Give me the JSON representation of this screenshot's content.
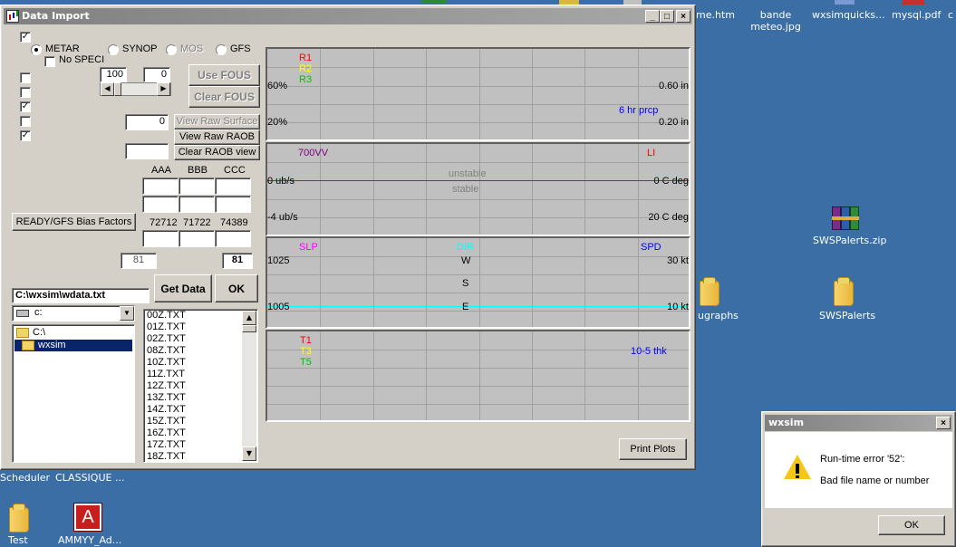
{
  "desktop": {
    "icons": [
      {
        "label": "me.htm"
      },
      {
        "label": "bande meteo.jpg"
      },
      {
        "label": "wxsimquicks..."
      },
      {
        "label": "mysql.pdf"
      },
      {
        "label": "c"
      },
      {
        "label": "SWSPalerts.zip"
      },
      {
        "label": "ugraphs"
      },
      {
        "label": "SWSPalerts"
      },
      {
        "label": "Scheduler"
      },
      {
        "label": "CLASSIQUE ..."
      },
      {
        "label": "Test"
      },
      {
        "label": "AMMYY_Ad..."
      }
    ],
    "ammyy_glyph": "A"
  },
  "main_window": {
    "title": "Data Import",
    "minimize": "_",
    "maximize": "□",
    "close": "×",
    "radios": {
      "metar": "METAR",
      "synop": "SYNOP",
      "mos": "MOS",
      "gfs": "GFS"
    },
    "no_speci": "No SPECI",
    "check_mark": "✓",
    "field_100": "100",
    "field_0a": "0",
    "use_fous": "Use FOUS",
    "clear_fous": "Clear FOUS",
    "field_0b": "0",
    "view_raw_surface": "View Raw Surface",
    "view_raw_raob": "View Raw RAOB",
    "clear_raob_view": "Clear RAOB view",
    "col_aaa": "AAA",
    "col_bbb": "BBB",
    "col_ccc": "CCC",
    "bias_button": "READY/GFS Bias Factors",
    "station1": "72712",
    "station2": "71722",
    "station3": "74389",
    "count_left": "81",
    "count_right": "81",
    "path": "C:\\wxsim\\wdata.txt",
    "get_data": "Get Data",
    "ok": "OK",
    "drive": "c:",
    "dirs": [
      "C:\\",
      "wxsim"
    ],
    "files": [
      "00Z.TXT",
      "01Z.TXT",
      "02Z.TXT",
      "08Z.TXT",
      "10Z.TXT",
      "11Z.TXT",
      "12Z.TXT",
      "13Z.TXT",
      "14Z.TXT",
      "15Z.TXT",
      "16Z.TXT",
      "17Z.TXT",
      "18Z.TXT"
    ],
    "print_plots": "Print Plots"
  },
  "plots": {
    "p1": {
      "r1": "R1",
      "r2": "R2",
      "r3": "R3",
      "left_top": "60%",
      "left_bottom": "20%",
      "right_top": "0.60 in",
      "right_bottom": "0.20 in",
      "series": "6 hr prcp"
    },
    "p2": {
      "title_left": "700VV",
      "title_right": "LI",
      "unstable": "unstable",
      "stable": "stable",
      "left_top": "0 ub/s",
      "left_bottom": "-4 ub/s",
      "right_top": "0 C deg",
      "right_bottom": "20 C deg"
    },
    "p3": {
      "slp": "SLP",
      "dir": "DIR",
      "spd": "SPD",
      "left_top": "1025",
      "left_bottom": "1005",
      "w": "W",
      "s": "S",
      "e": "E",
      "right_top": "30 kt",
      "right_bottom": "10 kt"
    },
    "p4": {
      "t1": "T1",
      "t3": "T3",
      "t5": "T5",
      "series": "10-5 thk"
    }
  },
  "error_dialog": {
    "title": "wxsim",
    "close": "×",
    "line1": "Run-time error '52':",
    "line2": "Bad file name or number",
    "ok": "OK"
  },
  "colors": {
    "red": "#ff0000",
    "yellow": "#ffff00",
    "green": "#00c000",
    "purple": "#800080",
    "cyan": "#00ffff",
    "blue": "#0000ff",
    "grey": "#808080"
  }
}
